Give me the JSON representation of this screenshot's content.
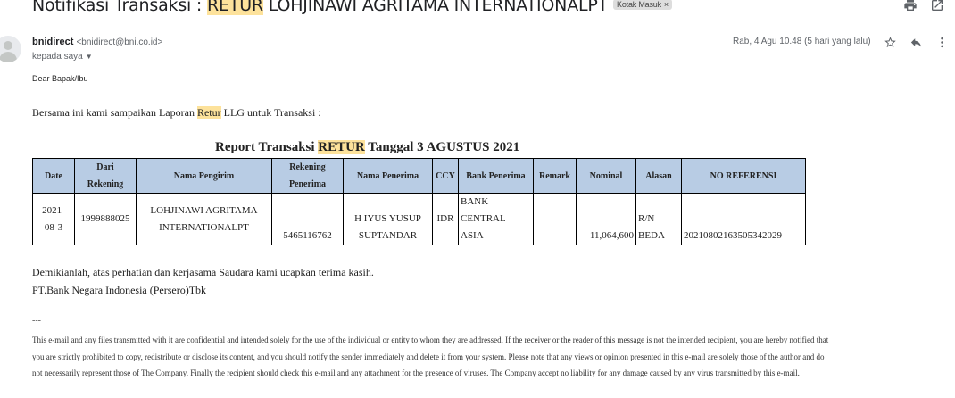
{
  "subject": {
    "prefix": "Notifikasi Transaksi : ",
    "highlight": "RETUR",
    "suffix": " LOHJINAWI AGRITAMA INTERNATIONALPT",
    "label_chip": "Kotak Masuk",
    "chip_close": "×"
  },
  "message": {
    "sender_name": "bnidirect",
    "sender_email": "<bnidirect@bni.co.id>",
    "recipient": "kepada saya",
    "date": "Rab, 4 Agu 10.48 (5 hari yang lalu)"
  },
  "body": {
    "greeting": "Dear Bapak/Ibu",
    "intro_before": "Bersama ini kami sampaikan Laporan ",
    "intro_highlight": "Retur",
    "intro_after": " LLG untuk Transaksi :",
    "report_title_before": "Report Transaksi ",
    "report_title_highlight": "RETUR",
    "report_title_after": " Tanggal 3 AGUSTUS 2021",
    "closing_line1": "Demikianlah, atas perhatian dan kerjasama Saudara kami ucapkan terima kasih.",
    "closing_line2": "PT.Bank Negara Indonesia (Persero)Tbk",
    "separator": "---",
    "disclaimer": [
      "This e-mail and any files transmitted with it are confidential and intended solely for the use of the individual or entity to whom they are addressed. If the receiver or the reader of this message is not the intended recipient, you are hereby notified that",
      "you are strictly prohibited to copy, redistribute or disclose its content, and you should notify the sender immediately and delete it from your system. Please note that any views or opinion presented in this e-mail are solely those of the author and do",
      "not necessarily represent those of The Company. Finally the recipient should check this e-mail and any attachment for the presence of viruses. The Company accept no liability for any damage caused by any virus transmitted by this e-mail."
    ]
  },
  "table": {
    "headers": {
      "date": "Date",
      "dari_line1": "Dari",
      "dari_line2": "Rekening",
      "nama_pengirim": "Nama Pengirim",
      "rek_penerima_line1": "Rekening",
      "rek_penerima_line2": "Penerima",
      "nama_penerima": "Nama Penerima",
      "ccy": "CCY",
      "bank_penerima": "Bank Penerima",
      "remark": "Remark",
      "nominal": "Nominal",
      "alasan": "Alasan",
      "no_referensi": "NO REFERENSI"
    },
    "row": {
      "date_line1": "2021-",
      "date_line2": "08-3",
      "dari_rekening": "1999888025",
      "pengirim_line1": "LOHJINAWI AGRITAMA",
      "pengirim_line2": "INTERNATIONALPT",
      "rekening_penerima": "5465116762",
      "penerima_line1": "H IYUS YUSUP",
      "penerima_line2": "SUPTANDAR",
      "ccy": "IDR",
      "bank_line1": "BANK",
      "bank_line2": "CENTRAL",
      "bank_line3": "ASIA",
      "remark": "",
      "nominal": "11,064,600",
      "alasan_line1": "R/N",
      "alasan_line2": "BEDA",
      "no_referensi": "20210802163505342029"
    }
  },
  "icons": {
    "print": "print-icon",
    "open_new_window": "open-new-window-icon",
    "star": "star-icon",
    "reply": "reply-icon",
    "more": "more-vert-icon",
    "avatar": "avatar-icon"
  },
  "colors": {
    "highlight": "#fde29b",
    "table_header": "#b8cce4"
  }
}
